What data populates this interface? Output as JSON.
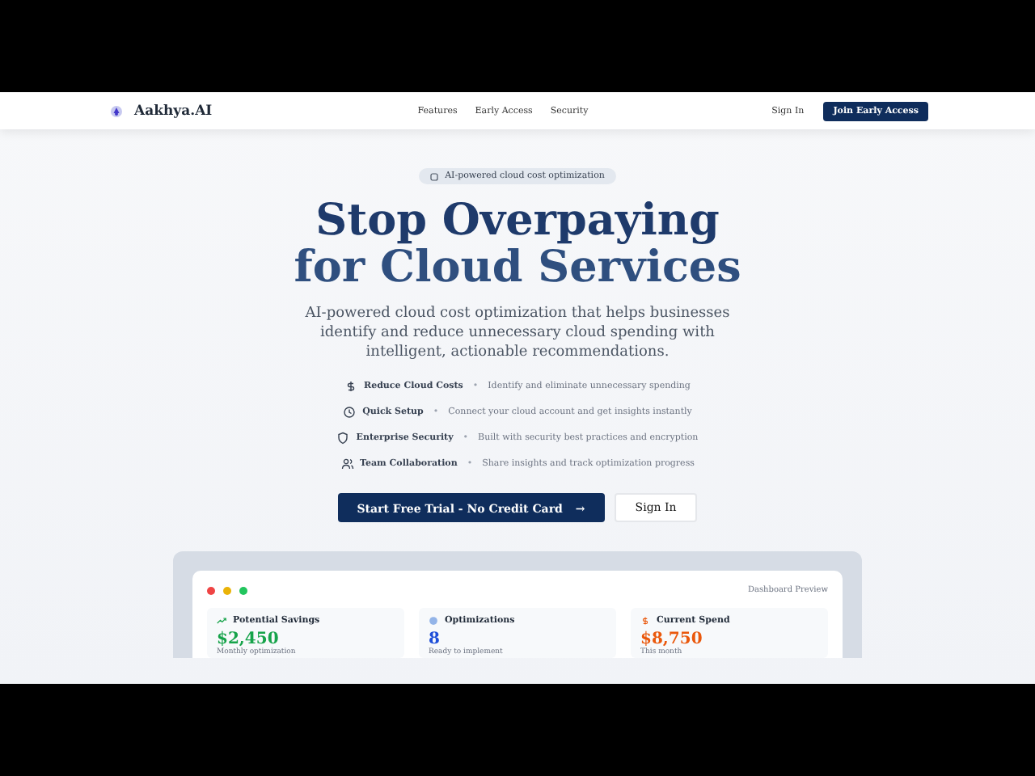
{
  "nav": {
    "brand": "Aakhya.AI",
    "links": [
      "Features",
      "Early Access",
      "Security"
    ],
    "sign_in": "Sign In",
    "cta": "Join Early Access"
  },
  "hero": {
    "badge": "AI-powered cloud cost optimization",
    "title_line1": "Stop Overpaying",
    "title_line2": "for Cloud Services",
    "subtitle": "AI-powered cloud cost optimization that helps businesses identify and reduce unnecessary cloud spending with intelligent, actionable recommendations.",
    "features": [
      {
        "kind": "dollar",
        "title": "Reduce Cloud Costs",
        "separator": "•",
        "text": "Identify and eliminate unnecessary spending"
      },
      {
        "kind": "clock",
        "title": "Quick Setup",
        "separator": "•",
        "text": "Connect your cloud account and get insights instantly"
      },
      {
        "kind": "shield",
        "title": "Enterprise Security",
        "separator": "•",
        "text": "Built with security best practices and encryption"
      },
      {
        "kind": "users",
        "title": "Team Collaboration",
        "separator": "•",
        "text": "Share insights and track optimization progress"
      }
    ],
    "primary_button": "Start Free Trial - No Credit Card",
    "primary_arrow": "→",
    "secondary_button": "Sign In"
  },
  "preview": {
    "label": "Dashboard Preview",
    "dots": [
      {
        "color": "#ef4444"
      },
      {
        "color": "#eab308"
      },
      {
        "color": "#22c55e"
      }
    ],
    "cards": [
      {
        "kind": "trend",
        "title": "Potential Savings",
        "value": "$2,450",
        "note": "Monthly optimization",
        "color": "#16a34a"
      },
      {
        "kind": "circle",
        "title": "Optimizations",
        "value": "8",
        "note": "Ready to implement",
        "color": "#1d4ed8"
      },
      {
        "kind": "dollar",
        "title": "Current Spend",
        "value": "$8,750",
        "note": "This month",
        "color": "#ea580c"
      }
    ]
  }
}
